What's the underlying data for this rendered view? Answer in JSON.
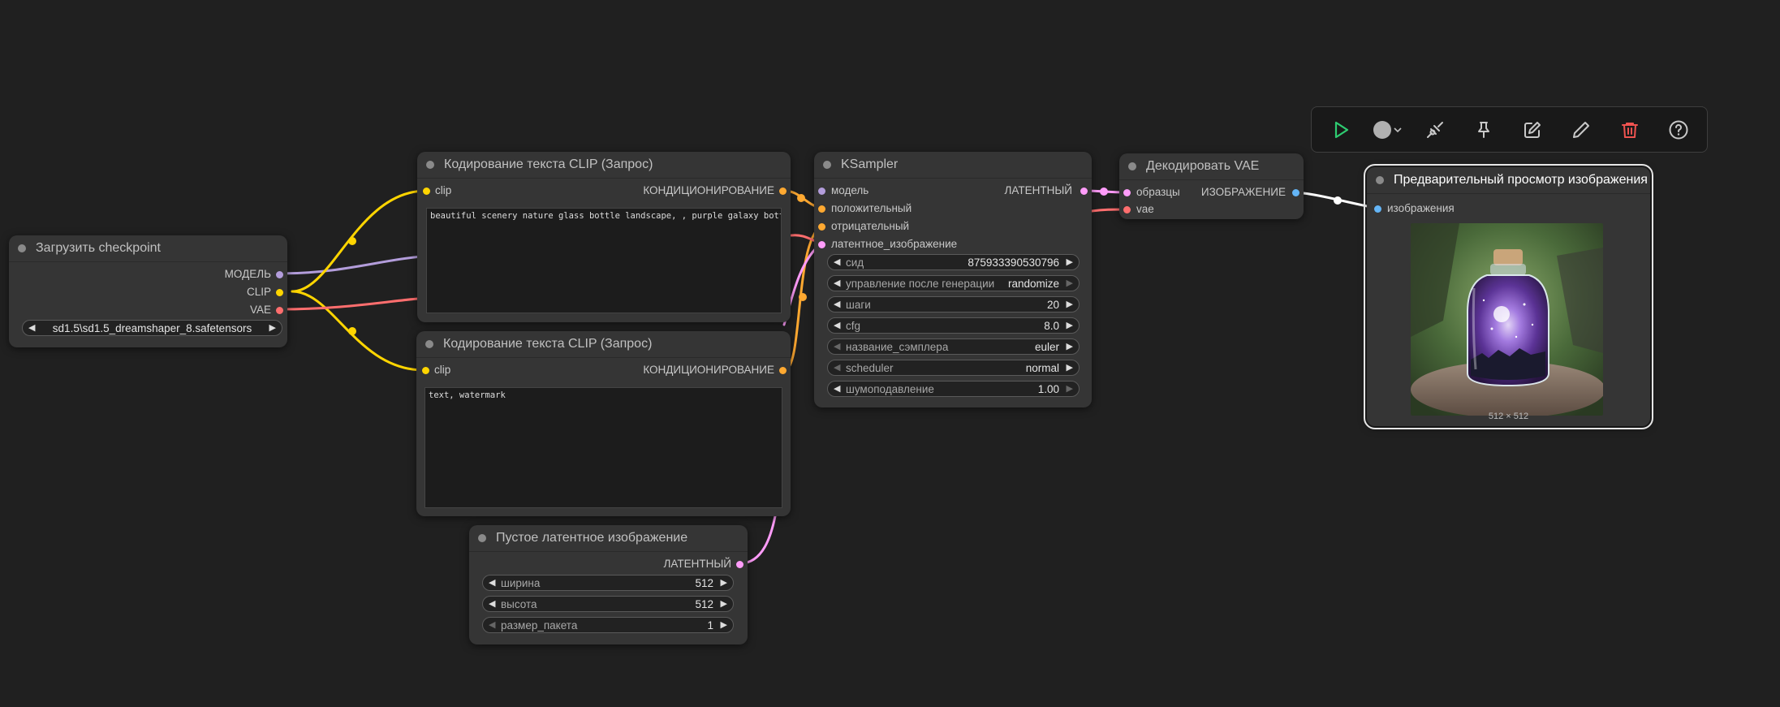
{
  "colors": {
    "background": "#202020",
    "node": "#353535",
    "model": "#b39ddb",
    "clip": "#ffd500",
    "vae": "#ff6e6e",
    "conditioning": "#ffa931",
    "latent": "#ff9cf9",
    "image": "#64b5f6",
    "run": "#2ecc71",
    "delete": "#ef5350"
  },
  "toolbar": {
    "icons": [
      "play-icon",
      "color-circle-icon",
      "chevron-down-icon",
      "bypass-icon",
      "pin-icon",
      "edit-icon",
      "pencil-icon",
      "trash-icon",
      "help-icon"
    ]
  },
  "checkpoint": {
    "title": "Загрузить checkpoint",
    "outputs": {
      "model": "МОДЕЛЬ",
      "clip": "CLIP",
      "vae": "VAE"
    },
    "ckpt_name": "sd1.5\\sd1.5_dreamshaper_8.safetensors"
  },
  "clip_pos": {
    "title": "Кодирование текста CLIP (Запрос)",
    "input": "clip",
    "output": "КОНДИЦИОНИРОВАНИЕ",
    "text": "beautiful scenery nature glass bottle landscape, , purple galaxy bottle,"
  },
  "clip_neg": {
    "title": "Кодирование текста CLIP (Запрос)",
    "input": "clip",
    "output": "КОНДИЦИОНИРОВАНИЕ",
    "text": "text, watermark"
  },
  "latent": {
    "title": "Пустое латентное изображение",
    "output": "ЛАТЕНТНЫЙ",
    "width_label": "ширина",
    "width": "512",
    "height_label": "высота",
    "height": "512",
    "batch_label": "размер_пакета",
    "batch": "1"
  },
  "ksampler": {
    "title": "KSampler",
    "inputs": {
      "model": "модель",
      "positive": "положительный",
      "negative": "отрицательный",
      "latent": "латентное_изображение"
    },
    "output": "ЛАТЕНТНЫЙ",
    "seed_label": "сид",
    "seed": "875933390530796",
    "control_label": "управление после генерации",
    "control": "randomize",
    "steps_label": "шаги",
    "steps": "20",
    "cfg_label": "cfg",
    "cfg": "8.0",
    "sampler_label": "название_сэмплера",
    "sampler": "euler",
    "scheduler_label": "scheduler",
    "scheduler": "normal",
    "denoise_label": "шумоподавление",
    "denoise": "1.00"
  },
  "vae_decode": {
    "title": "Декодировать VAE",
    "inputs": {
      "samples": "образцы",
      "vae": "vae"
    },
    "output": "ИЗОБРАЖЕНИЕ"
  },
  "preview": {
    "title": "Предварительный просмотр изображения",
    "input": "изображения",
    "size": "512 × 512"
  }
}
